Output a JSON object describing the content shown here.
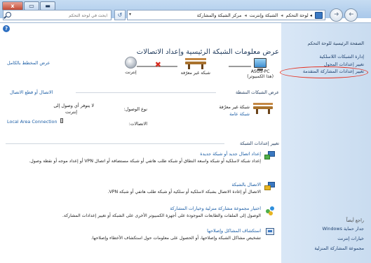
{
  "window": {
    "controls": {
      "minimize": "▬",
      "maximize": "▭",
      "close": "x"
    }
  },
  "navigation": {
    "search_placeholder": "ابحث في لوحة التحكم",
    "refresh_glyph": "↺",
    "dropdown_glyph": "▾",
    "breadcrumbs": [
      "لوحة التحكم",
      "الشبكة وإنترنت",
      "مركز الشبكة والمشاركة"
    ],
    "breadcrumb_separator": "◂"
  },
  "sidebar": {
    "links": [
      {
        "label": "الصفحة الرئيسية للوحة التحكم"
      },
      {
        "label": "إدارة الشبكات اللاسلكية"
      },
      {
        "label": "تغيير إعدادات المحول"
      },
      {
        "label": "تغيير إعدادات المشاركة المتقدمة"
      }
    ],
    "see_also_heading": "راجع أيضاً",
    "see_also_links": [
      {
        "label": "جدار حماية Windows"
      },
      {
        "label": "خيارات إنترنت"
      },
      {
        "label": "مجموعة المشاركة المنزلية"
      }
    ],
    "highlighted_item_color": "#e53223"
  },
  "main": {
    "title": "عرض معلومات الشبكة الرئيسية وإعداد الاتصالات",
    "view_full_map": "عرض المخطط بالكامل",
    "map": {
      "computer_name": "ASUS-PC",
      "computer_sub": "(هذا الكمبيوتر)",
      "network_name": "شبكة غير معرّفة",
      "internet_label": "إنترنت"
    },
    "active_networks": {
      "heading": "عرض الشبكات النشطة",
      "connect_disconnect": "الاتصال أو قطع الاتصال",
      "network_name": "شبكة غير معرّفة",
      "network_type": "شبكة عامة",
      "access_type_label": "نوع الوصول:",
      "access_type_value_line1": "لا يتوفر أي وصول إلى",
      "access_type_value_line2": "إنترنت",
      "connections_label": "الاتصالات:",
      "connection_link": "Local Area Connection"
    },
    "change_settings": {
      "heading": "تغيير إعدادات الشبكة",
      "tasks": [
        {
          "icon": "new-connection-icon",
          "title": "إعداد اتصال جديد أو شبكة جديدة",
          "description": "إعداد شبكة لاسلكية أو شبكة واسعة النطاق أو شبكة طلب هاتفي أو شبكة مستضافة أو اتصال VPN أو إعداد موجه أو نقطة وصول."
        },
        {
          "icon": "connect-to-network-icon",
          "title": "الاتصال بالشبكة",
          "description": "الاتصال أو إعادة الاتصال بشبكة لاسلكية أو سلكية أو شبكة طلب هاتفي أو شبكة VPN."
        },
        {
          "icon": "homegroup-icon",
          "title": "اختيار مجموعة مشاركة منزلية وخيارات المشاركة",
          "description": "الوصول إلى الملفات والطابعات الموجودة على أجهزة الكمبيوتر الأخرى على الشبكة أو تغيير إعدادات المشاركة."
        },
        {
          "icon": "troubleshoot-icon",
          "title": "استكشاف المشاكل وإصلاحها",
          "description": "تشخيص مشاكل الشبكة وإصلاحها، أو الحصول على معلومات حول استكشاف الأخطاء وإصلاحها."
        }
      ]
    }
  }
}
